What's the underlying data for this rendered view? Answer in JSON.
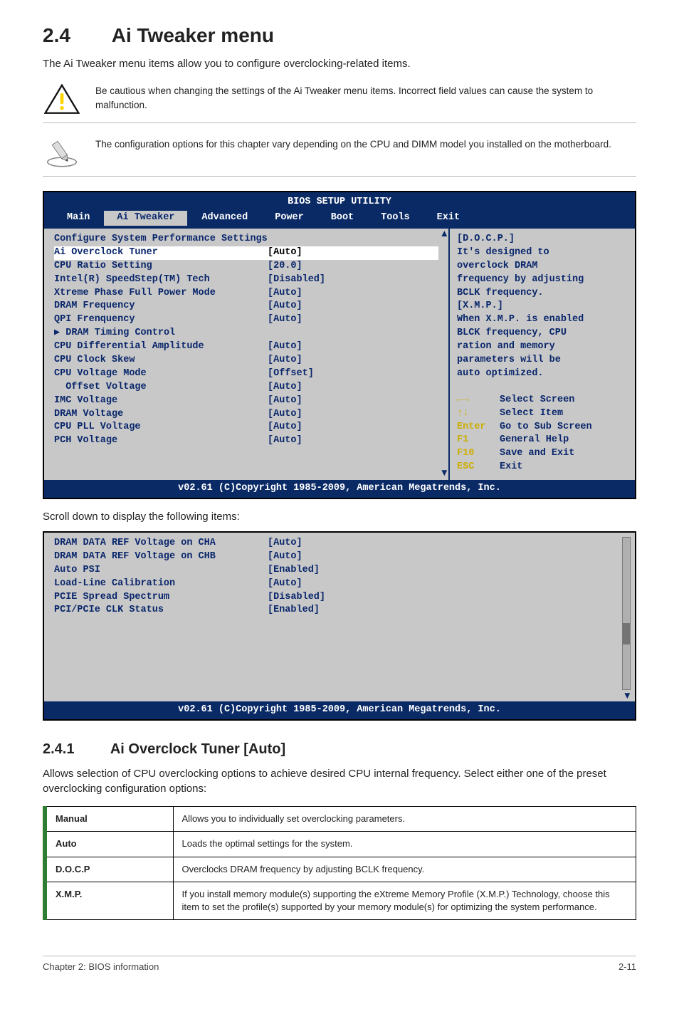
{
  "header": {
    "num": "2.4",
    "title": "Ai Tweaker menu"
  },
  "intro": "The Ai Tweaker menu items allow you to configure overclocking-related items.",
  "notes": {
    "caution": "Be cautious when changing the settings of the Ai Tweaker menu items. Incorrect field values can cause the system to malfunction.",
    "info": "The configuration options for this chapter vary depending on the CPU and DIMM model you installed on the motherboard."
  },
  "bios": {
    "title": "BIOS SETUP UTILITY",
    "tabs": [
      "Main",
      "Ai Tweaker",
      "Advanced",
      "Power",
      "Boot",
      "Tools",
      "Exit"
    ],
    "active_tab": "Ai Tweaker",
    "config_header": "Configure System Performance Settings",
    "rows": [
      {
        "label": "Ai Overclock Tuner",
        "value": "[Auto]",
        "hl": true
      },
      {
        "label": "CPU Ratio Setting",
        "value": "[20.0]"
      },
      {
        "label": "Intel(R) SpeedStep(TM) Tech",
        "value": "[Disabled]"
      },
      {
        "label": "Xtreme Phase Full Power Mode",
        "value": "[Auto]"
      },
      {
        "label": "DRAM Frequency",
        "value": "[Auto]"
      },
      {
        "label": "QPI Frenquency",
        "value": "[Auto]"
      },
      {
        "label": "",
        "value": ""
      },
      {
        "label": "DRAM Timing Control",
        "value": "",
        "sub": true
      },
      {
        "label": "CPU Differential Amplitude",
        "value": "[Auto]"
      },
      {
        "label": "CPU Clock Skew",
        "value": "[Auto]"
      },
      {
        "label": "",
        "value": ""
      },
      {
        "label": "",
        "value": ""
      },
      {
        "label": "CPU Voltage Mode",
        "value": "[Offset]"
      },
      {
        "label": "  Offset Voltage",
        "value": "[Auto]"
      },
      {
        "label": "IMC Voltage",
        "value": "[Auto]"
      },
      {
        "label": "DRAM Voltage",
        "value": "[Auto]"
      },
      {
        "label": "CPU PLL Voltage",
        "value": "[Auto]"
      },
      {
        "label": "PCH Voltage",
        "value": "[Auto]"
      }
    ],
    "help_lines": [
      "[D.O.C.P.]",
      "It's designed to",
      "overclock DRAM",
      "frequency by adjusting",
      "BCLK frequency.",
      "[X.M.P.]",
      "When X.M.P. is enabled",
      "BLCK frequency, CPU",
      "ration and memory",
      "parameters will be",
      "auto optimized."
    ],
    "nav": {
      "select_screen": "Select Screen",
      "select_item": "Select Item",
      "enter": "Go to Sub Screen",
      "f1": "General Help",
      "f10": "Save and Exit",
      "esc": "Exit"
    },
    "footer": "v02.61 (C)Copyright 1985-2009, American Megatrends, Inc."
  },
  "scroll_caption": "Scroll down to display the following items:",
  "bios2": {
    "rows": [
      {
        "label": "DRAM DATA REF Voltage on CHA",
        "value": "[Auto]"
      },
      {
        "label": "DRAM DATA REF Voltage on CHB",
        "value": "[Auto]"
      },
      {
        "label": "Auto PSI",
        "value": "[Enabled]"
      },
      {
        "label": "",
        "value": ""
      },
      {
        "label": "Load-Line Calibration",
        "value": "[Auto]"
      },
      {
        "label": "PCIE Spread Spectrum",
        "value": "[Disabled]"
      },
      {
        "label": "PCI/PCIe CLK Status",
        "value": "[Enabled]"
      }
    ],
    "footer": "v02.61 (C)Copyright 1985-2009, American Megatrends, Inc."
  },
  "subsection": {
    "num": "2.4.1",
    "title": "Ai Overclock Tuner [Auto]"
  },
  "subintro": "Allows selection of CPU overclocking options to achieve desired CPU internal frequency. Select either one of the preset overclocking configuration options:",
  "options": [
    {
      "name": "Manual",
      "desc": "Allows you to individually set overclocking parameters."
    },
    {
      "name": "Auto",
      "desc": "Loads the optimal settings for the system."
    },
    {
      "name": "D.O.C.P",
      "desc": "Overclocks DRAM frequency by adjusting BCLK frequency."
    },
    {
      "name": "X.M.P.",
      "desc": "If you install memory module(s) supporting the eXtreme Memory Profile (X.M.P.) Technology, choose this item to set the profile(s) supported by your memory module(s) for optimizing the system performance."
    }
  ],
  "footer": {
    "left": "Chapter 2: BIOS information",
    "right": "2-11"
  }
}
